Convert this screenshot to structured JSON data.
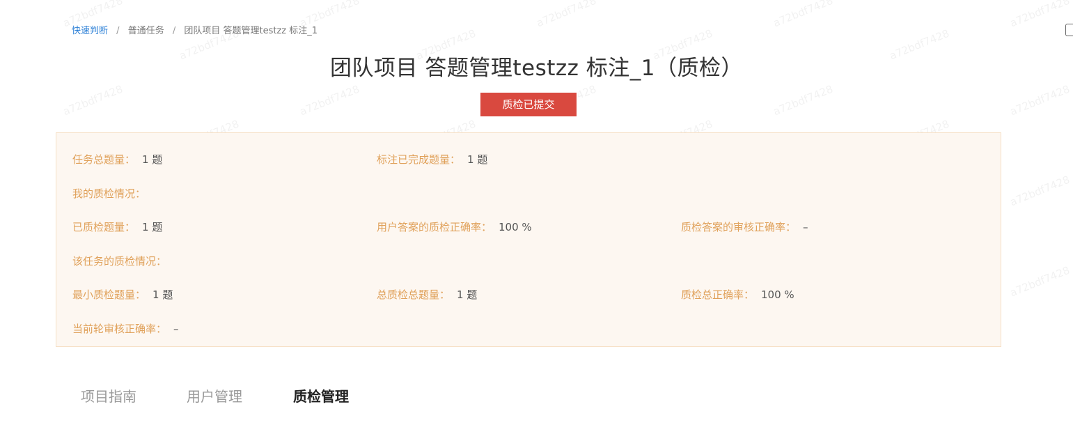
{
  "watermark": "a72bdf7428",
  "breadcrumb": {
    "items": [
      "快速判断",
      "普通任务",
      "团队项目 答题管理testzz 标注_1"
    ],
    "separator": "/"
  },
  "title": "团队项目 答题管理testzz 标注_1（质检）",
  "status_badge": "质检已提交",
  "info": {
    "total_questions": {
      "label": "任务总题量：",
      "value": "1 题"
    },
    "labeled_done": {
      "label": "标注已完成题量：",
      "value": "1 题"
    },
    "my_qc_heading": "我的质检情况：",
    "qc_checked": {
      "label": "已质检题量：",
      "value": "1 题"
    },
    "user_answer_qc_accuracy": {
      "label": "用户答案的质检正确率：",
      "value": "100 %"
    },
    "qc_answer_review_accuracy": {
      "label": "质检答案的审核正确率：",
      "value": "–"
    },
    "task_qc_heading": "该任务的质检情况：",
    "min_qc": {
      "label": "最小质检题量：",
      "value": "1 题"
    },
    "total_qc": {
      "label": "总质检总题量：",
      "value": "1 题"
    },
    "qc_total_accuracy": {
      "label": "质检总正确率：",
      "value": "100 %"
    },
    "current_review_accuracy": {
      "label": "当前轮审核正确率：",
      "value": "–"
    }
  },
  "tabs": [
    "项目指南",
    "用户管理",
    "质检管理"
  ],
  "active_tab": "质检管理",
  "colors": {
    "accent_link": "#2b7fd6",
    "badge_bg": "#d9493f",
    "panel_bg": "#fdf7f1",
    "panel_border": "#f6dfc5",
    "label_color": "#e0a15a"
  }
}
